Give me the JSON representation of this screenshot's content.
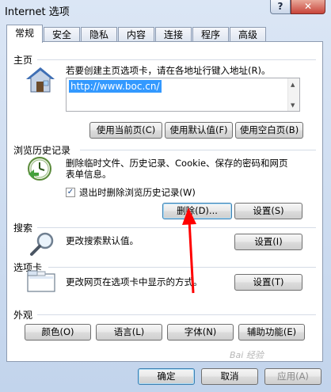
{
  "window": {
    "title": "Internet 选项",
    "help_glyph": "?",
    "close_glyph": "✕"
  },
  "tabs": [
    {
      "label": "常规",
      "active": true
    },
    {
      "label": "安全"
    },
    {
      "label": "隐私"
    },
    {
      "label": "内容"
    },
    {
      "label": "连接"
    },
    {
      "label": "程序"
    },
    {
      "label": "高级"
    }
  ],
  "homepage": {
    "section_label": "主页",
    "description": "若要创建主页选项卡，请在各地址行键入地址(R)。",
    "url_value": "http://www.boc.cn/",
    "buttons": {
      "use_current": "使用当前页(C)",
      "use_default": "使用默认值(F)",
      "use_blank": "使用空白页(B)"
    }
  },
  "history": {
    "section_label": "浏览历史记录",
    "description_line1": "删除临时文件、历史记录、Cookie、保存的密码和网页",
    "description_line2": "表单信息。",
    "checkbox_label": "退出时删除浏览历史记录(W)",
    "checkbox_checked": true,
    "buttons": {
      "delete": "删除(D)...",
      "settings": "设置(S)"
    }
  },
  "search": {
    "section_label": "搜索",
    "description": "更改搜索默认值。",
    "settings_button": "设置(I)"
  },
  "tabs_section": {
    "section_label": "选项卡",
    "description": "更改网页在选项卡中显示的方式。",
    "settings_button": "设置(T)"
  },
  "appearance": {
    "section_label": "外观",
    "buttons": {
      "colors": "颜色(O)",
      "languages": "语言(L)",
      "fonts": "字体(N)",
      "accessibility": "辅助功能(E)"
    }
  },
  "footer": {
    "ok": "确定",
    "cancel": "取消",
    "apply": "应用(A)"
  },
  "watermark": "Bai 经验",
  "colors": {
    "annotation_arrow": "#ff0000",
    "selection": "#3399ff",
    "accent": "#3c7fb1"
  }
}
